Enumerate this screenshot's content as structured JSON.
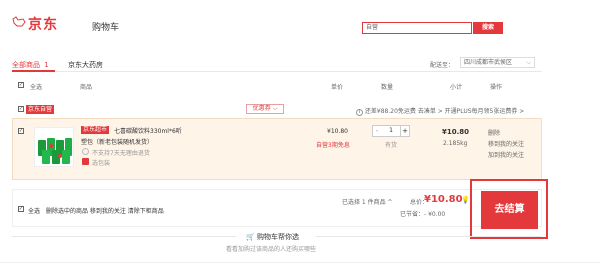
{
  "header": {
    "logo": "京东",
    "title": "购物车",
    "search_value": "自营",
    "search_button": "搜索"
  },
  "tabs": {
    "all": "全部商品",
    "all_count": "1",
    "pharmacy": "京东大药房"
  },
  "shipping": {
    "label": "配送至：",
    "region": "四川成都市武侯区"
  },
  "columns": {
    "select_all": "全选",
    "product": "商品",
    "price": "单价",
    "quantity": "数量",
    "subtotal": "小计",
    "actions": "操作"
  },
  "shop": {
    "tag": "京东自营",
    "coupon": "优惠券",
    "plus_info": "还差¥88.20免运费  去凑单 > 开通PLUS每月领5张运费券 >"
  },
  "item": {
    "tag": "京东超市",
    "title": "七喜碳酸饮料330ml*6听",
    "subtitle": "塑包（新老包装随机发货）",
    "return_note": "不支持7天无理由退货",
    "gift_note": "选包装",
    "price": "¥10.80",
    "promo": "自营3期免息",
    "quantity": "1",
    "minus": "-",
    "plus": "+",
    "stock": "有货",
    "subtotal": "¥10.80",
    "weight": "2.185kg",
    "action_delete": "删除",
    "action_follow": "移到我的关注",
    "action_favorite": "加到我的关注"
  },
  "footer": {
    "select_all": "全选",
    "links": "删除选中的商品   移到我的关注   清除下柜商品",
    "selected_count": "已选择 1 件商品 ^",
    "total_label": "总价：",
    "total_value": "¥10.80",
    "saved": "已节省：- ¥0.00",
    "checkout": "去结算"
  },
  "recommend": {
    "title": "购物车帮你选",
    "subtitle": "看看加购过该商品的人还购买哪些"
  },
  "colors": {
    "brand_red": "#e4393c",
    "item_bg": "#fff4e8"
  }
}
